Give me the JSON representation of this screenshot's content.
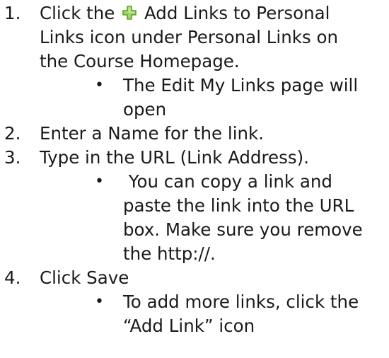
{
  "steps": [
    {
      "number": "1.",
      "lines": [
        "Click the",
        "Add Links to Personal",
        "Links icon under Personal Links on",
        "the Course Homepage."
      ],
      "icon": "add-plus-icon",
      "bullets": [
        {
          "symbol": "•",
          "lines": [
            "The Edit My Links page will",
            "open"
          ]
        }
      ]
    },
    {
      "number": "2.",
      "lines": [
        "Enter a Name for the link."
      ],
      "bullets": []
    },
    {
      "number": "3.",
      "lines": [
        "Type in the URL (Link Address)."
      ],
      "bullets": [
        {
          "symbol": "•",
          "lines": [
            " You can copy a link and",
            "paste the link into the URL",
            "box. Make sure you remove",
            "the http://."
          ]
        }
      ]
    },
    {
      "number": "4.",
      "lines": [
        "Click Save"
      ],
      "bullets": [
        {
          "symbol": "•",
          "lines": [
            "To add more links, click the",
            "“Add Link” icon"
          ]
        }
      ]
    }
  ],
  "colors": {
    "text": "#1a1a1a",
    "icon_fill": "#9fd66b",
    "icon_stroke": "#5e9e2c"
  }
}
